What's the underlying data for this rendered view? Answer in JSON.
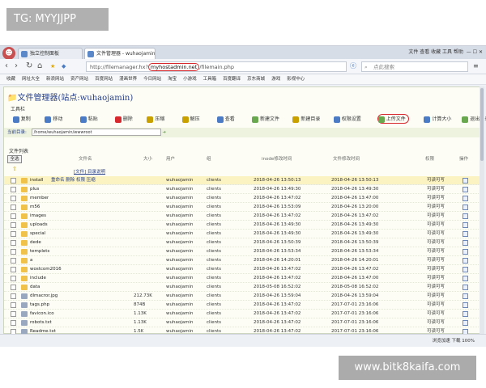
{
  "watermark_top": "TG: MYYJJPP",
  "watermark_bottom": "www.bitk8kaifa.com",
  "browser": {
    "tabs": [
      "独立控制面板",
      "文件管理器 - wuhaojamin"
    ],
    "window_controls": "文件 查看 收藏 工具 帮助",
    "nav": {
      "back": "‹",
      "forward": "›",
      "reload": "↻",
      "home": "⌂"
    },
    "url_prefix": "http://filemanager.hx?",
    "url_highlight": "myhostadmin.net",
    "url_suffix": "/filemain.php",
    "search_placeholder": "点此搜索",
    "bookmarks": [
      "收藏",
      "网址大全",
      "新浪网站",
      "资产网站",
      "百度网站",
      "漫画世界",
      "今日网站",
      "淘宝",
      "小游戏",
      "工具箱",
      "百度翻译",
      "京东商城",
      "游戏",
      "影视中心"
    ]
  },
  "page": {
    "title": "文件管理器(站点:wuhaojamin)",
    "toolbar_label": "工具栏",
    "toolbar": [
      {
        "label": "复制",
        "color": "#4a7bc4"
      },
      {
        "label": "移动",
        "color": "#4a7bc4"
      },
      {
        "label": "粘贴",
        "color": "#4a7bc4"
      },
      {
        "label": "删除",
        "color": "#d6282d"
      },
      {
        "label": "压缩",
        "color": "#c8a000"
      },
      {
        "label": "解压",
        "color": "#c8a000"
      },
      {
        "label": "查看",
        "color": "#4a7bc4"
      },
      {
        "label": "新建文件",
        "color": "#6aa84f"
      },
      {
        "label": "新建目录",
        "color": "#c8a000"
      },
      {
        "label": "权限设置",
        "color": "#4a7bc4"
      },
      {
        "label": "上传文件",
        "color": "#6aa84f"
      },
      {
        "label": "计算大小",
        "color": "#4a7bc4"
      },
      {
        "label": "退出登录",
        "color": "#6aa84f"
      }
    ],
    "current_dir_label": "当前目录:",
    "current_dir": "/home/wuhaojamin/wwwroot",
    "file_list_label": "文件列表",
    "select_all": "全选",
    "sub_info": "[文件] 目录说明",
    "columns": [
      "文件名",
      "大小",
      "用户",
      "组",
      "inode修改时间",
      "文件修改时间",
      "权限",
      "操作"
    ],
    "first_row_links": "重命名 删除 权限 压缩",
    "rows": [
      {
        "name": "install",
        "size": "",
        "user": "wuhaojamin",
        "group": "clients",
        "inode": "2018-04-26 13:50:13",
        "mtime": "2018-04-26 13:50:13",
        "perm": "可读可写",
        "folder": true
      },
      {
        "name": "plus",
        "size": "",
        "user": "wuhaojamin",
        "group": "clients",
        "inode": "2018-04-26 13:49:30",
        "mtime": "2018-04-26 13:49:30",
        "perm": "可读可写",
        "folder": true
      },
      {
        "name": "member",
        "size": "",
        "user": "wuhaojamin",
        "group": "clients",
        "inode": "2018-04-26 13:47:02",
        "mtime": "2018-04-26 13:47:00",
        "perm": "可读可写",
        "folder": true
      },
      {
        "name": "m56",
        "size": "",
        "user": "wuhaojamin",
        "group": "clients",
        "inode": "2018-04-26 13:53:09",
        "mtime": "2018-04-26 13:20:00",
        "perm": "可读可写",
        "folder": true
      },
      {
        "name": "images",
        "size": "",
        "user": "wuhaojamin",
        "group": "clients",
        "inode": "2018-04-26 13:47:02",
        "mtime": "2018-04-26 13:47:02",
        "perm": "可读可写",
        "folder": true
      },
      {
        "name": "uploads",
        "size": "",
        "user": "wuhaojamin",
        "group": "clients",
        "inode": "2018-04-26 13:49:30",
        "mtime": "2018-04-26 13:49:30",
        "perm": "可读可写",
        "folder": true
      },
      {
        "name": "special",
        "size": "",
        "user": "wuhaojamin",
        "group": "clients",
        "inode": "2018-04-26 13:49:30",
        "mtime": "2018-04-26 13:49:30",
        "perm": "可读可写",
        "folder": true
      },
      {
        "name": "dede",
        "size": "",
        "user": "wuhaojamin",
        "group": "clients",
        "inode": "2018-04-26 13:50:39",
        "mtime": "2018-04-26 13:50:39",
        "perm": "可读可写",
        "folder": true
      },
      {
        "name": "templets",
        "size": "",
        "user": "wuhaojamin",
        "group": "clients",
        "inode": "2018-04-26 13:53:34",
        "mtime": "2018-04-26 13:53:34",
        "perm": "可读可写",
        "folder": true
      },
      {
        "name": "a",
        "size": "",
        "user": "wuhaojamin",
        "group": "clients",
        "inode": "2018-04-26 14:20:01",
        "mtime": "2018-04-26 14:20:01",
        "perm": "可读可写",
        "folder": true
      },
      {
        "name": "wostcom2016",
        "size": "",
        "user": "wuhaojamin",
        "group": "clients",
        "inode": "2018-04-26 13:47:02",
        "mtime": "2018-04-26 13:47:02",
        "perm": "可读可写",
        "folder": true
      },
      {
        "name": "include",
        "size": "",
        "user": "wuhaojamin",
        "group": "clients",
        "inode": "2018-04-26 13:47:02",
        "mtime": "2018-04-26 13:47:00",
        "perm": "可读可写",
        "folder": true
      },
      {
        "name": "data",
        "size": "",
        "user": "wuhaojamin",
        "group": "clients",
        "inode": "2018-05-08 16:52:02",
        "mtime": "2018-05-08 16:52:02",
        "perm": "可读可写",
        "folder": true
      },
      {
        "name": "dlmacror.jpg",
        "size": "212.73K",
        "user": "wuhaojamin",
        "group": "clients",
        "inode": "2018-04-26 13:59:04",
        "mtime": "2018-04-26 13:59:04",
        "perm": "可读可写",
        "folder": false
      },
      {
        "name": "tags.php",
        "size": "874B",
        "user": "wuhaojamin",
        "group": "clients",
        "inode": "2018-04-26 13:47:02",
        "mtime": "2017-07-01 23:16:06",
        "perm": "可读可写",
        "folder": false
      },
      {
        "name": "favicon.ico",
        "size": "1.13K",
        "user": "wuhaojamin",
        "group": "clients",
        "inode": "2018-04-26 13:47:02",
        "mtime": "2017-07-01 23:16:06",
        "perm": "可读可写",
        "folder": false
      },
      {
        "name": "robots.txt",
        "size": "1.13K",
        "user": "wuhaojamin",
        "group": "clients",
        "inode": "2018-04-26 13:47:02",
        "mtime": "2017-07-01 23:16:06",
        "perm": "可读可写",
        "folder": false
      },
      {
        "name": "Readme.txt",
        "size": "1.5K",
        "user": "wuhaojamin",
        "group": "clients",
        "inode": "2018-04-26 13:47:02",
        "mtime": "2017-07-01 23:16:06",
        "perm": "可读可写",
        "folder": false
      }
    ]
  },
  "status": {
    "left": "",
    "right": "浏览加速  下载  100%"
  }
}
